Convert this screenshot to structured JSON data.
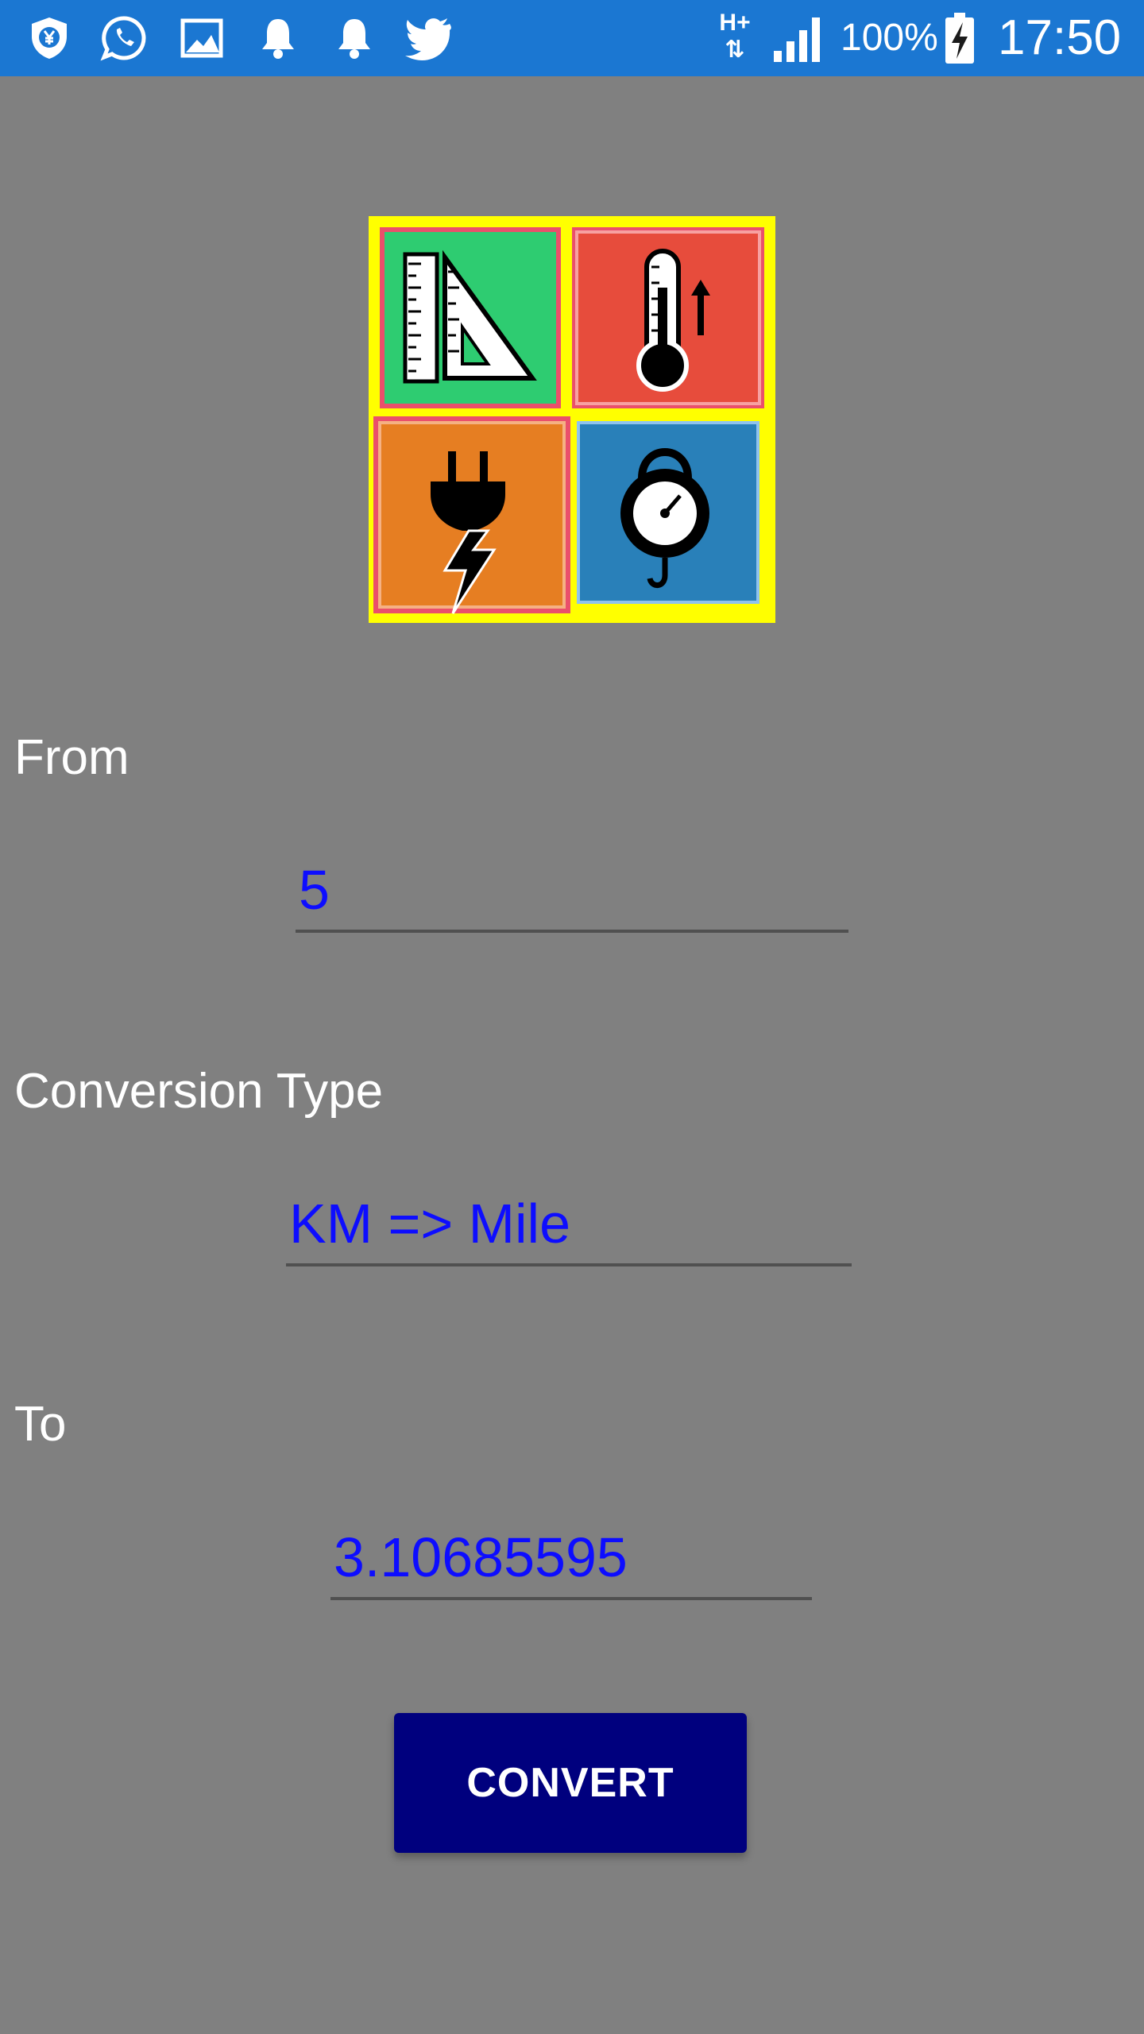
{
  "status_bar": {
    "left_icons": [
      "shield-yen-icon",
      "whatsapp-icon",
      "gallery-icon",
      "bell-icon",
      "bell-icon",
      "twitter-icon"
    ],
    "network_type_top": "H+",
    "battery_percent": "100%",
    "time": "17:50",
    "background_color": "#1b77d2"
  },
  "logo": {
    "tiles": [
      "ruler-triangle-icon",
      "thermometer-icon",
      "plug-lightning-icon",
      "hanging-scale-icon"
    ],
    "colors": {
      "frame": "#ffff00",
      "green": "#2ecc71",
      "red": "#e74c3c",
      "orange": "#e67e22",
      "blue": "#2980b9"
    }
  },
  "form": {
    "from_label": "From",
    "from_value": "5",
    "conversion_type_label": "Conversion Type",
    "conversion_type_value": "KM => Mile",
    "to_label": "To",
    "to_value": "3.10685595",
    "convert_button": "CONVERT"
  },
  "colors": {
    "page_background": "#808080",
    "value_text": "#0d0dff",
    "button": "#00007e"
  }
}
